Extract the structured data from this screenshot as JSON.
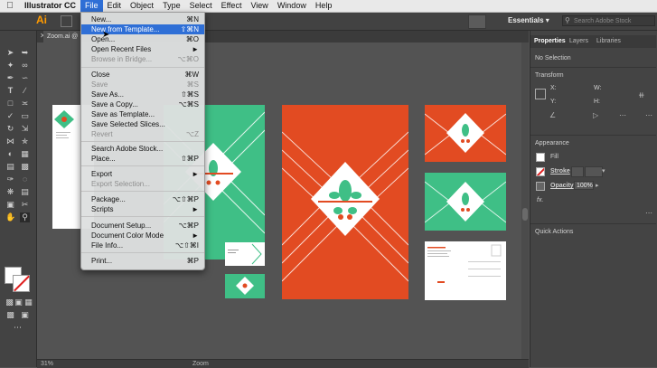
{
  "menubar": {
    "app_name": "Illustrator CC",
    "items": [
      "File",
      "Edit",
      "Object",
      "Type",
      "Select",
      "Effect",
      "View",
      "Window",
      "Help"
    ]
  },
  "appbar": {
    "logo": "Ai",
    "workspace": "Essentials",
    "search_placeholder": "Search Adobe Stock"
  },
  "document": {
    "tab_label": "Zoom.ai @",
    "zoom_value": "31%",
    "status_label": "Zoom"
  },
  "file_menu": {
    "items": [
      {
        "label": "New...",
        "shortcut": "⌘N",
        "state": "enabled"
      },
      {
        "label": "New from Template...",
        "shortcut": "⇧⌘N",
        "state": "highlighted"
      },
      {
        "label": "Open...",
        "shortcut": "⌘O",
        "state": "enabled"
      },
      {
        "label": "Open Recent Files",
        "shortcut": "►",
        "state": "enabled"
      },
      {
        "label": "Browse in Bridge...",
        "shortcut": "⌥⌘O",
        "state": "disabled"
      },
      {
        "label": "Close",
        "shortcut": "⌘W",
        "state": "enabled"
      },
      {
        "label": "Save",
        "shortcut": "⌘S",
        "state": "disabled"
      },
      {
        "label": "Save As...",
        "shortcut": "⇧⌘S",
        "state": "enabled"
      },
      {
        "label": "Save a Copy...",
        "shortcut": "⌥⌘S",
        "state": "enabled"
      },
      {
        "label": "Save as Template...",
        "shortcut": "",
        "state": "enabled"
      },
      {
        "label": "Save Selected Slices...",
        "shortcut": "",
        "state": "enabled"
      },
      {
        "label": "Revert",
        "shortcut": "⌥Z",
        "state": "disabled"
      },
      {
        "label": "Search Adobe Stock...",
        "shortcut": "",
        "state": "enabled"
      },
      {
        "label": "Place...",
        "shortcut": "⇧⌘P",
        "state": "enabled"
      },
      {
        "label": "Export",
        "shortcut": "►",
        "state": "enabled"
      },
      {
        "label": "Export Selection...",
        "shortcut": "",
        "state": "disabled"
      },
      {
        "label": "Package...",
        "shortcut": "⌥⇧⌘P",
        "state": "enabled"
      },
      {
        "label": "Scripts",
        "shortcut": "►",
        "state": "enabled"
      },
      {
        "label": "Document Setup...",
        "shortcut": "⌥⌘P",
        "state": "enabled"
      },
      {
        "label": "Document Color Mode",
        "shortcut": "►",
        "state": "enabled"
      },
      {
        "label": "File Info...",
        "shortcut": "⌥⇧⌘I",
        "state": "enabled"
      },
      {
        "label": "Print...",
        "shortcut": "⌘P",
        "state": "enabled"
      }
    ]
  },
  "panel": {
    "tabs": [
      "Properties",
      "Layers",
      "Libraries"
    ],
    "selection": "No Selection",
    "transform": {
      "title": "Transform",
      "x": "X:",
      "y": "Y:",
      "w": "W:",
      "h": "H:"
    },
    "appearance": {
      "title": "Appearance",
      "fill": "Fill",
      "stroke": "Stroke",
      "opacity_label": "Opacity",
      "opacity_value": "100%",
      "fx": "fx."
    },
    "quick_actions": "Quick Actions"
  },
  "colors": {
    "accent": "#2f6fd6",
    "green_art": "#3fbf86",
    "orange_art": "#e24b22",
    "logo": "#ff9a00"
  }
}
